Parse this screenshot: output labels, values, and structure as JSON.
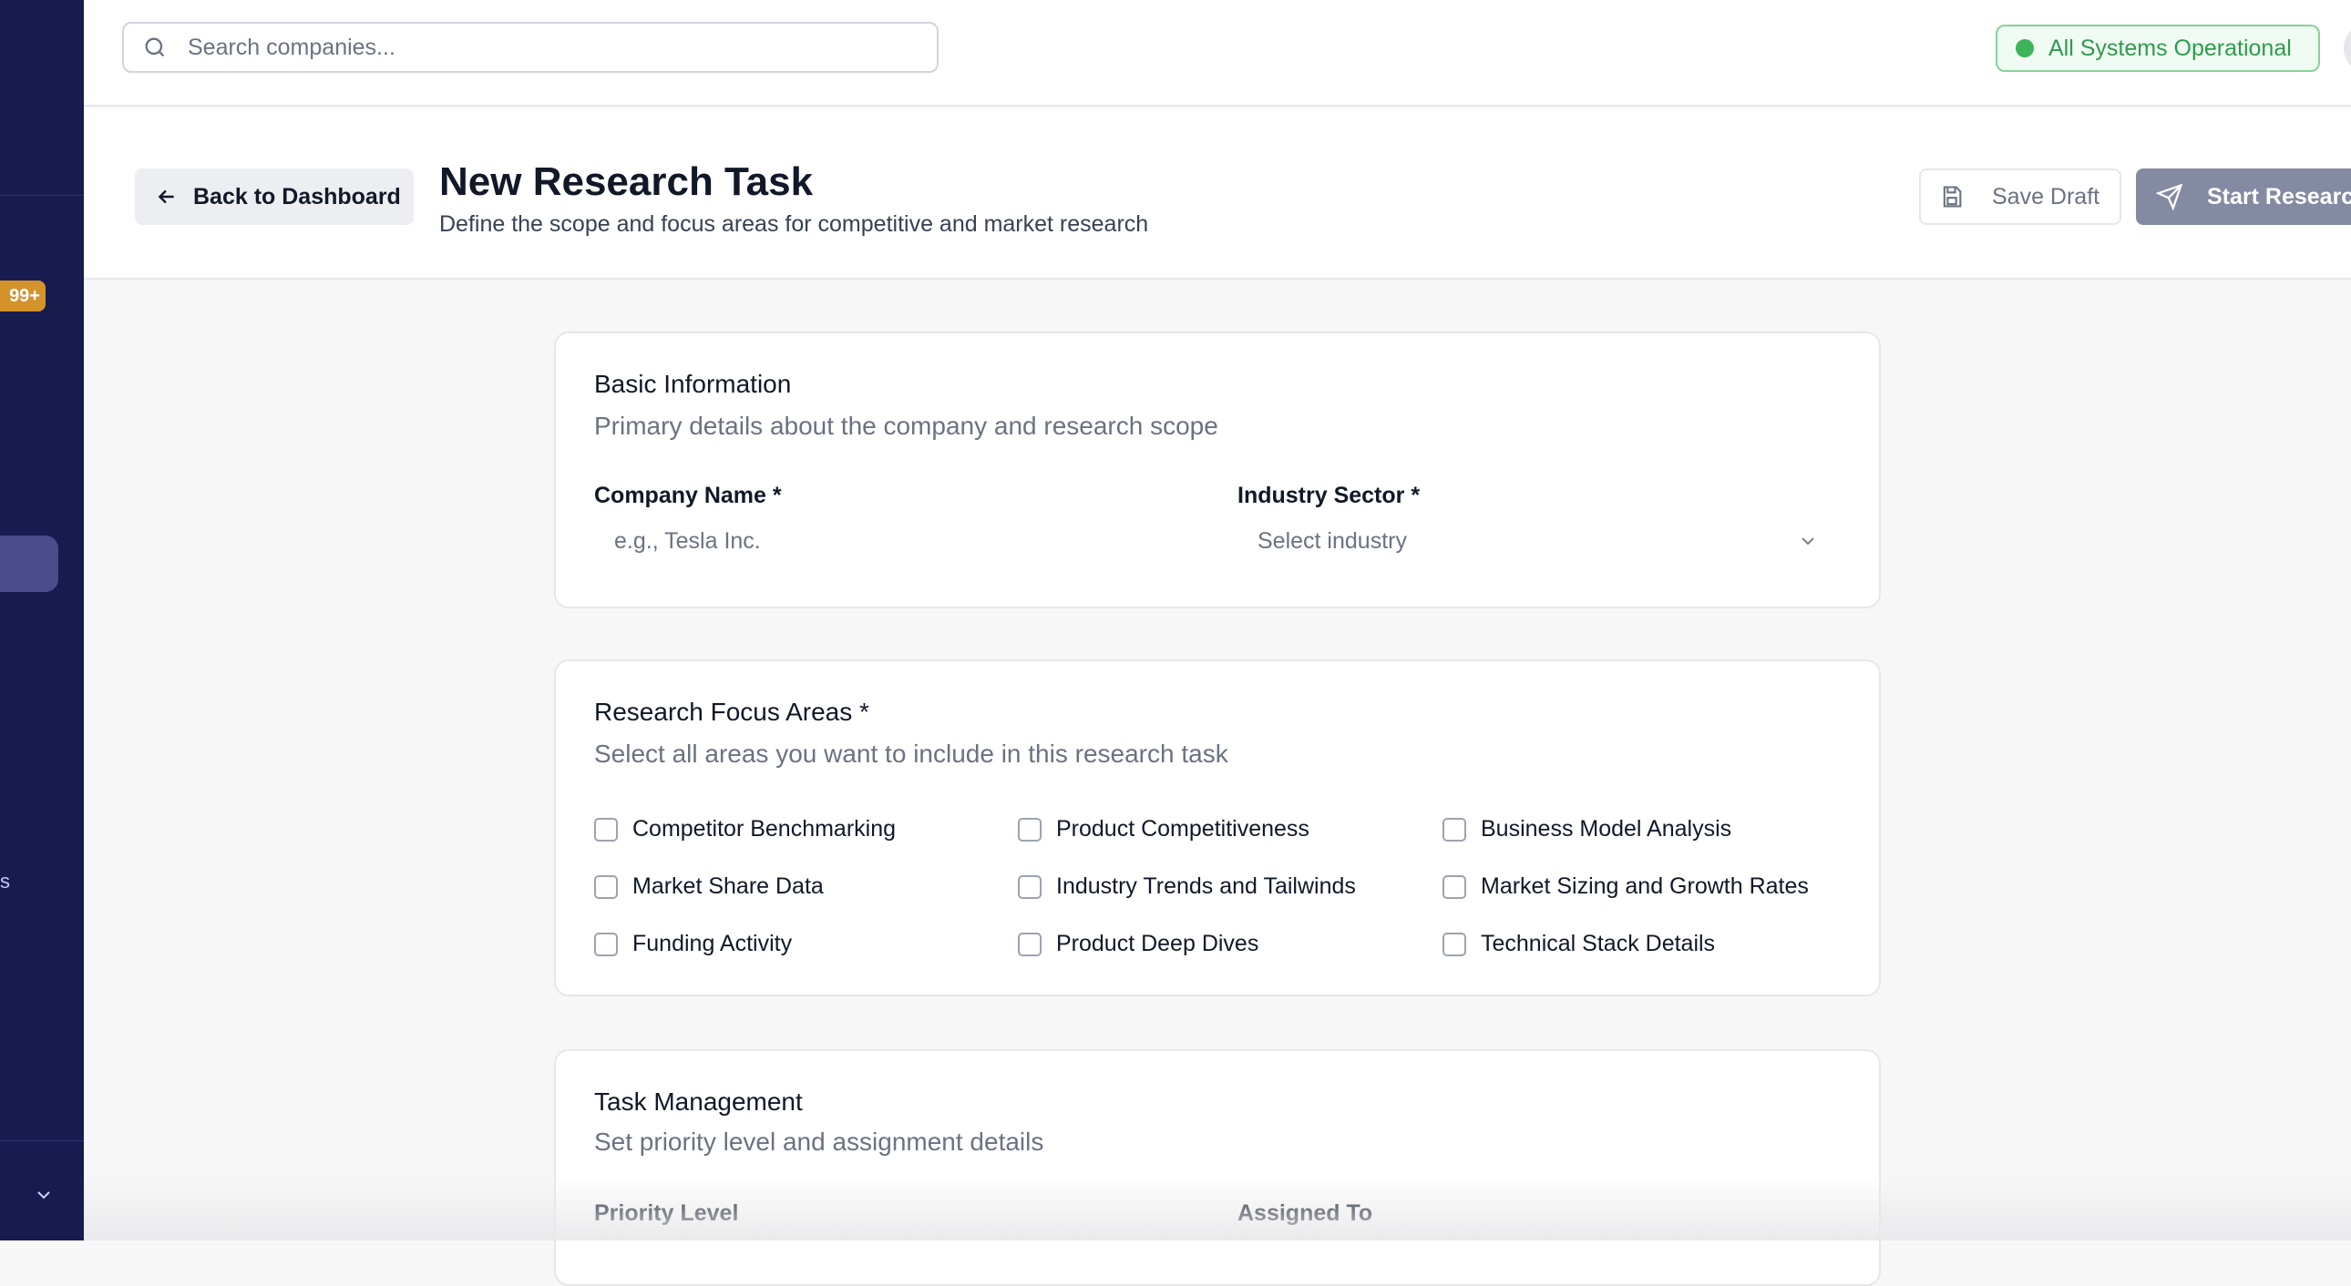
{
  "sidebar": {
    "badge": "99+",
    "stray_char": "s"
  },
  "topbar": {
    "search_placeholder": "Search companies...",
    "status_text": "All Systems Operational"
  },
  "header": {
    "back_label": "Back to Dashboard",
    "title": "New Research Task",
    "subtitle": "Define the scope and focus areas for competitive and market research",
    "save_draft_label": "Save Draft",
    "start_research_label": "Start Research"
  },
  "basic_info": {
    "title": "Basic Information",
    "description": "Primary details about the company and research scope",
    "company_label": "Company Name *",
    "company_placeholder": "e.g., Tesla Inc.",
    "industry_label": "Industry Sector *",
    "industry_placeholder": "Select industry"
  },
  "focus_areas": {
    "title": "Research Focus Areas *",
    "description": "Select all areas you want to include in this research task",
    "options": [
      "Competitor Benchmarking",
      "Product Competitiveness",
      "Business Model Analysis",
      "Market Share Data",
      "Industry Trends and Tailwinds",
      "Market Sizing and Growth Rates",
      "Funding Activity",
      "Product Deep Dives",
      "Technical Stack Details"
    ]
  },
  "task_management": {
    "title": "Task Management",
    "description": "Set priority level and assignment details",
    "priority_label": "Priority Level",
    "assigned_label": "Assigned To"
  },
  "colors": {
    "sidebar_bg": "#181b50",
    "status_green": "#3db35a",
    "primary_button": "#858aa3",
    "badge": "#d4922b"
  }
}
